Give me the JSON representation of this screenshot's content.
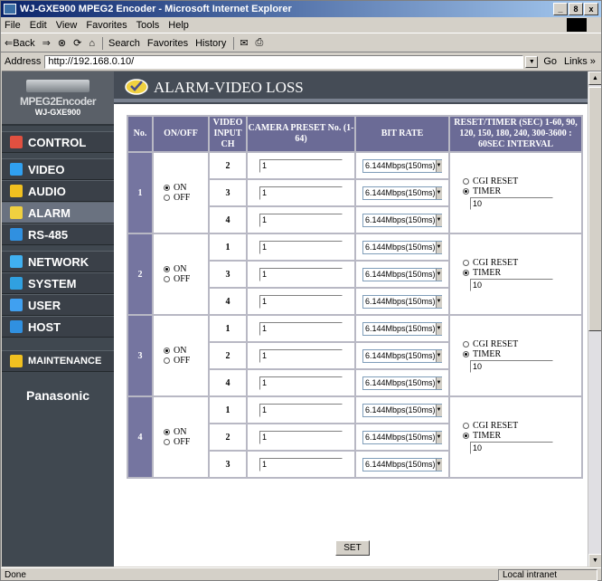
{
  "window": {
    "title": "WJ-GXE900 MPEG2 Encoder - Microsoft Internet Explorer",
    "controls": [
      "_",
      "8",
      "x"
    ]
  },
  "menu": [
    "File",
    "Edit",
    "View",
    "Favorites",
    "Tools",
    "Help"
  ],
  "toolbar": {
    "back": "⇐Back",
    "forward": "⇒",
    "search": "Search",
    "favorites": "Favorites",
    "history": "History"
  },
  "address": {
    "label": "Address",
    "url": "http://192.168.0.10/",
    "go": "Go",
    "links": "Links »"
  },
  "logo": {
    "line1": "MPEG2Encoder",
    "line2": "WJ-GXE900"
  },
  "nav": [
    {
      "label": "CONTROL",
      "icon": "control-icon",
      "color": "#e05040"
    },
    {
      "label": "VIDEO",
      "icon": "video-icon",
      "color": "#30a0f0"
    },
    {
      "label": "AUDIO",
      "icon": "audio-icon",
      "color": "#f0c020"
    },
    {
      "label": "ALARM",
      "icon": "alarm-icon",
      "color": "#f0d040"
    },
    {
      "label": "RS-485",
      "icon": "rs485-icon",
      "color": "#3090e0"
    },
    {
      "label": "NETWORK",
      "icon": "network-icon",
      "color": "#40b0f0"
    },
    {
      "label": "SYSTEM",
      "icon": "system-icon",
      "color": "#30a0e0"
    },
    {
      "label": "USER",
      "icon": "user-icon",
      "color": "#40a0f0"
    },
    {
      "label": "HOST",
      "icon": "host-icon",
      "color": "#3090e0"
    },
    {
      "label": "MAINTENANCE",
      "icon": "maintenance-icon",
      "color": "#f0c020"
    }
  ],
  "brand": "Panasonic",
  "page": {
    "title": "ALARM-VIDEO LOSS"
  },
  "table": {
    "headers": {
      "no": "No.",
      "onoff": "ON/OFF",
      "ch": "VIDEO INPUT CH",
      "preset": "CAMERA PRESET No. (1-64)",
      "bitrate": "BIT RATE",
      "reset": "RESET/TIMER (SEC) 1-60, 90, 120, 150, 180, 240, 300-3600 : 60SEC INTERVAL"
    },
    "on_label": "ON",
    "off_label": "OFF",
    "cgi_label": "CGI RESET",
    "timer_label": "TIMER",
    "groups": [
      {
        "no": "1",
        "chs": [
          "2",
          "3",
          "4"
        ],
        "presets": [
          "1",
          "1",
          "1"
        ],
        "bitrates": [
          "6.144Mbps(150ms)",
          "6.144Mbps(150ms)",
          "6.144Mbps(150ms)"
        ],
        "timer": "10"
      },
      {
        "no": "2",
        "chs": [
          "1",
          "3",
          "4"
        ],
        "presets": [
          "1",
          "1",
          "1"
        ],
        "bitrates": [
          "6.144Mbps(150ms)",
          "6.144Mbps(150ms)",
          "6.144Mbps(150ms)"
        ],
        "timer": "10"
      },
      {
        "no": "3",
        "chs": [
          "1",
          "2",
          "4"
        ],
        "presets": [
          "1",
          "1",
          "1"
        ],
        "bitrates": [
          "6.144Mbps(150ms)",
          "6.144Mbps(150ms)",
          "6.144Mbps(150ms)"
        ],
        "timer": "10"
      },
      {
        "no": "4",
        "chs": [
          "1",
          "2",
          "3"
        ],
        "presets": [
          "1",
          "1",
          "1"
        ],
        "bitrates": [
          "6.144Mbps(150ms)",
          "6.144Mbps(150ms)",
          "6.144Mbps(150ms)"
        ],
        "timer": "10"
      }
    ]
  },
  "set_label": "SET",
  "status": {
    "text": "Done",
    "zone": "Local intranet"
  }
}
